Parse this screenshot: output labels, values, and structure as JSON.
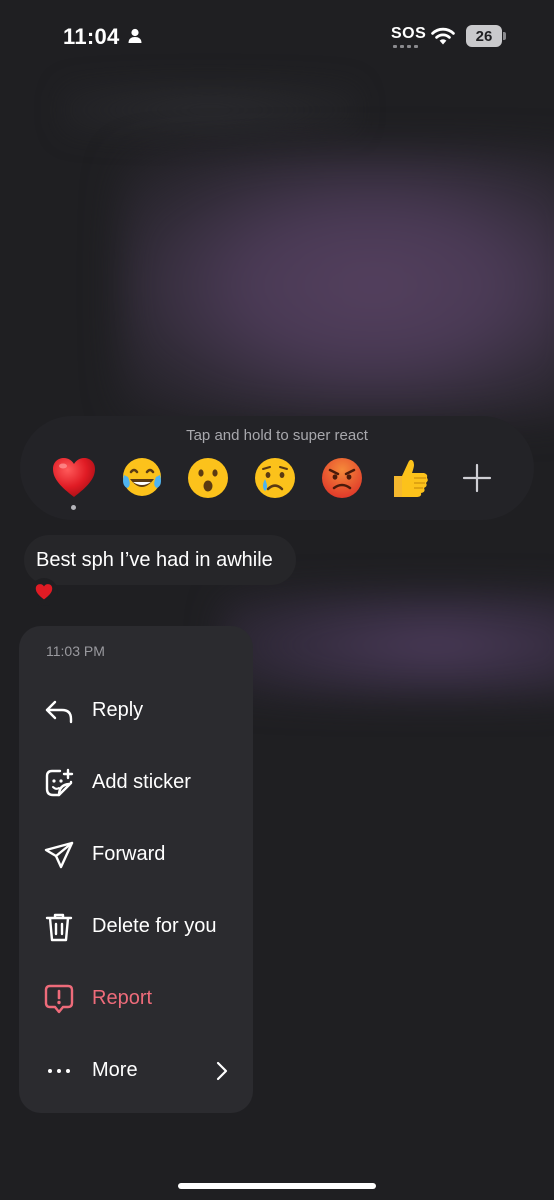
{
  "status_bar": {
    "time": "11:04",
    "sos": "SOS",
    "battery": "26",
    "icons": [
      "person-icon",
      "wifi-icon",
      "battery-icon"
    ]
  },
  "reactions": {
    "hint": "Tap and hold to super react",
    "emojis": [
      {
        "name": "red-heart",
        "glyph": "❤️"
      },
      {
        "name": "face-with-tears-of-joy",
        "glyph": "😂"
      },
      {
        "name": "surprised-face",
        "glyph": "😮"
      },
      {
        "name": "crying-face",
        "glyph": "😢"
      },
      {
        "name": "angry-face",
        "glyph": "😡"
      },
      {
        "name": "thumbs-up",
        "glyph": "👍"
      }
    ],
    "selected": "red-heart",
    "more_icon": "plus-icon"
  },
  "message": {
    "text": "Best sph I’ve had in awhile",
    "reaction": "❤️"
  },
  "context_menu": {
    "timestamp": "11:03 PM",
    "items": [
      {
        "label": "Reply",
        "icon": "reply-icon"
      },
      {
        "label": "Add sticker",
        "icon": "sticker-icon"
      },
      {
        "label": "Forward",
        "icon": "forward-icon"
      },
      {
        "label": "Delete for you",
        "icon": "trash-icon"
      },
      {
        "label": "Report",
        "icon": "report-icon"
      },
      {
        "label": "More",
        "icon": "more-icon"
      }
    ]
  },
  "colors": {
    "background": "#1f1f22",
    "menu": "#2b2b2f",
    "danger": "#ee6b7a",
    "accent_purple": "#54405e"
  }
}
